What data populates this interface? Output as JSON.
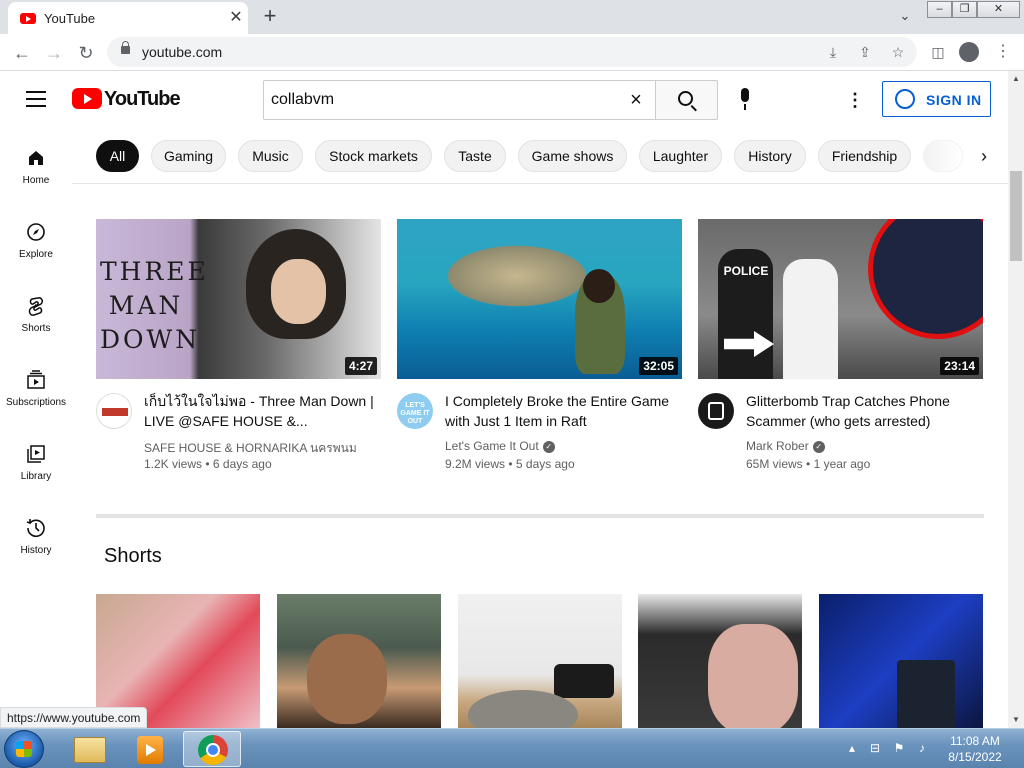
{
  "browser": {
    "tab_title": "YouTube",
    "tab_close": "✕",
    "new_tab": "+",
    "tab_search": "⌄",
    "url": "youtube.com",
    "status_url": "https://www.youtube.com"
  },
  "header": {
    "logo_text": "YouTube",
    "search_value": "collabvm",
    "signin_label": "SIGN IN"
  },
  "chips": [
    "All",
    "Gaming",
    "Music",
    "Stock markets",
    "Taste",
    "Game shows",
    "Laughter",
    "History",
    "Friendship"
  ],
  "sidebar": {
    "items": [
      {
        "label": "Home",
        "icon": "home-icon"
      },
      {
        "label": "Explore",
        "icon": "compass-icon"
      },
      {
        "label": "Shorts",
        "icon": "shorts-icon"
      },
      {
        "label": "Subscriptions",
        "icon": "subscriptions-icon"
      },
      {
        "label": "Library",
        "icon": "library-icon"
      },
      {
        "label": "History",
        "icon": "history-icon"
      }
    ]
  },
  "videos": [
    {
      "title": "เก็บไว้ในใจไม่พอ - Three Man Down | LIVE @SAFE HOUSE &...",
      "channel": "SAFE HOUSE & HORNARIKA นครพนม",
      "verified": false,
      "views": "1.2K views",
      "age": "6 days ago",
      "duration": "4:27",
      "thumb_text": "THREE MAN DOWN"
    },
    {
      "title": "I Completely Broke the Entire Game with Just 1 Item in Raft",
      "channel": "Let's Game It Out",
      "verified": true,
      "views": "9.2M views",
      "age": "5 days ago",
      "duration": "32:05",
      "avatar_text": "LET'S GAME IT OUT"
    },
    {
      "title": "Glitterbomb Trap Catches Phone Scammer (who gets arrested)",
      "channel": "Mark Rober",
      "verified": true,
      "views": "65M views",
      "age": "1 year ago",
      "duration": "23:14",
      "thumb_text": "POLICE"
    }
  ],
  "shorts": {
    "title": "Shorts"
  },
  "taskbar": {
    "time": "11:08 AM",
    "date": "8/15/2022"
  },
  "colors": {
    "youtube_red": "#ff0000",
    "link_blue": "#065fd4",
    "taskbar": "#6a93bd"
  }
}
